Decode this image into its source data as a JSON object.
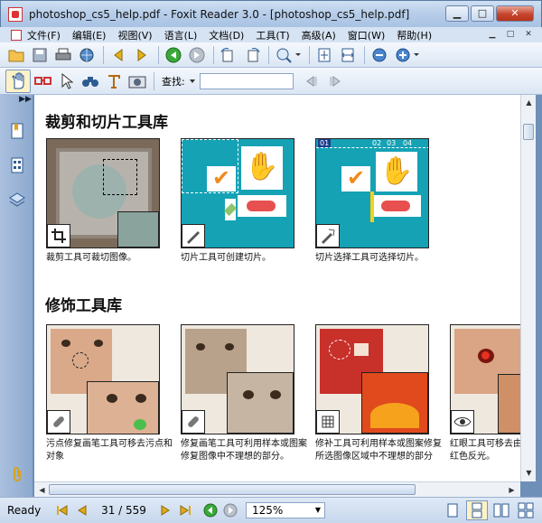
{
  "window": {
    "title": "photoshop_cs5_help.pdf - Foxit Reader 3.0 - [photoshop_cs5_help.pdf]",
    "min_glyph": "▁",
    "max_glyph": "□",
    "close_glyph": "✕"
  },
  "menu": {
    "items": [
      "文件(F)",
      "编辑(E)",
      "视图(V)",
      "语言(L)",
      "文档(D)",
      "工具(T)",
      "高级(A)",
      "窗口(W)",
      "帮助(H)"
    ]
  },
  "toolbar": {
    "find_label": "查找:",
    "find_value": ""
  },
  "content": {
    "section1_title": "裁剪和切片工具库",
    "section2_title": "修饰工具库",
    "captions": [
      "裁剪工具可裁切图像。",
      "切片工具可创建切片。",
      "切片选择工具可选择切片。",
      "污点修复画笔工具可移去污点和对象",
      "修复画笔工具可利用样本或图案修复图像中不理想的部分。",
      "修补工具可利用样本或图案修复所选图像区域中不理想的部分",
      "红眼工具可移去由闪光灯导致的红色反光。"
    ],
    "slice_labels": [
      "01",
      "02",
      "03",
      "04"
    ]
  },
  "status": {
    "state": "Ready",
    "page_indicator": "31 / 559",
    "zoom": "125%"
  },
  "colors": {
    "accent": "#6e8fb8",
    "teal": "#15a2b5",
    "status_active": "#fff2c6"
  }
}
